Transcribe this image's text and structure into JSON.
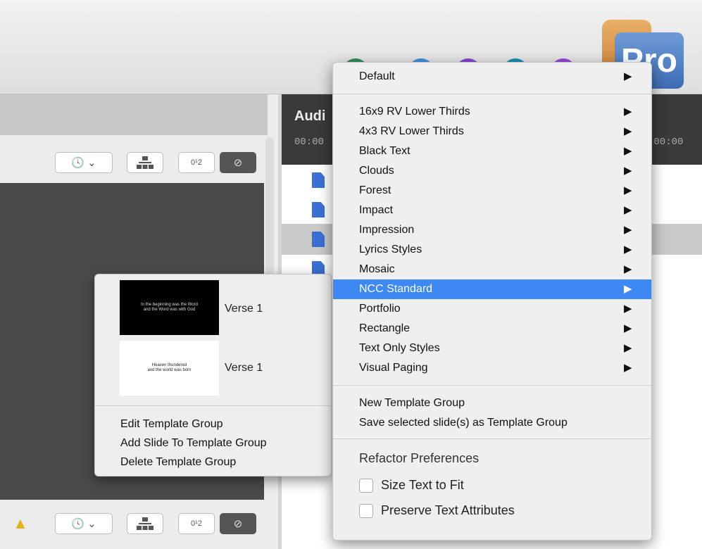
{
  "toolbar": {
    "pro_logo_text": "Pro",
    "colors": {
      "green": "#2f8f5a",
      "blue": "#3a90e0",
      "purple": "#8c46d6",
      "teal": "#1f8fb8",
      "violet": "#9c44d8"
    }
  },
  "right_header": {
    "title": "Audi",
    "time_left": "00:00",
    "time_right": ":00:00"
  },
  "template_popup": {
    "slides": [
      {
        "thumb_text": "In the beginning was the Word\nand the Word was with God",
        "label": "Verse 1"
      },
      {
        "thumb_text": "Heaven thundered\nand the world was born",
        "label": "Verse 1"
      }
    ],
    "items": [
      "Edit Template Group",
      "Add Slide To Template Group",
      "Delete Template Group"
    ]
  },
  "template_menu": {
    "default_item": "Default",
    "items": [
      "16x9 RV Lower Thirds",
      "4x3 RV Lower Thirds",
      "Black Text",
      "Clouds",
      "Forest",
      "Impact",
      "Impression",
      "Lyrics Styles",
      "Mosaic",
      "NCC Standard",
      "Portfolio",
      "Rectangle",
      "Text Only Styles",
      "Visual Paging"
    ],
    "selected_item": "NCC Standard",
    "actions": [
      "New Template Group",
      "Save selected slide(s) as Template Group"
    ],
    "refactor_heading": "Refactor Preferences",
    "checkboxes": [
      {
        "label": "Size Text to Fit",
        "checked": false
      },
      {
        "label": "Preserve Text Attributes",
        "checked": false
      }
    ],
    "accent_color": "#3e88f4"
  },
  "warning_icon": "warning-triangle-icon"
}
